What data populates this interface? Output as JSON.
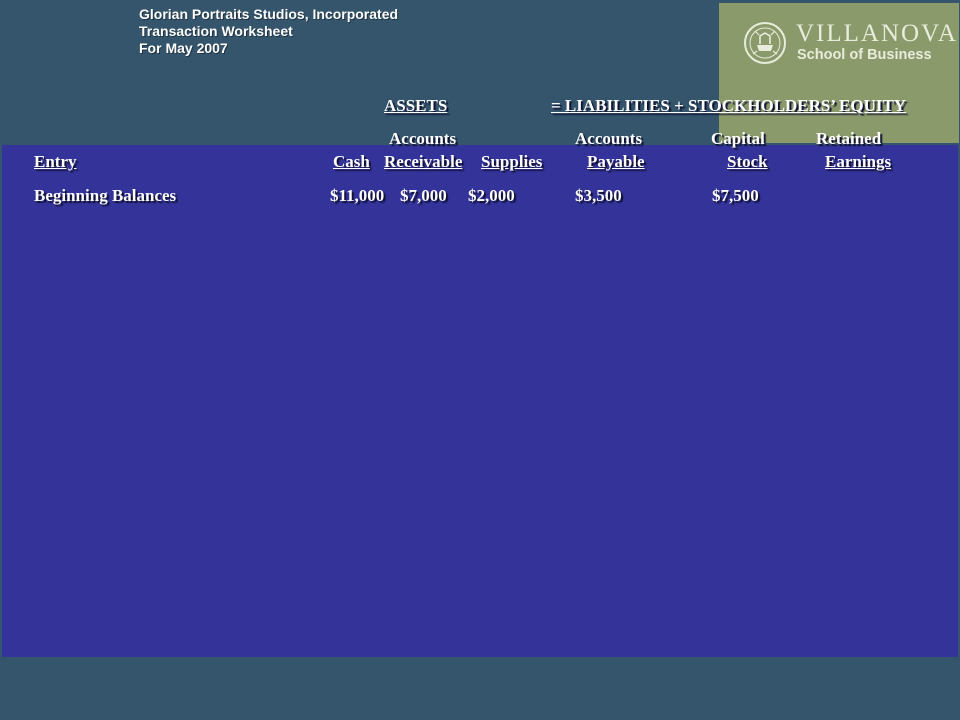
{
  "header": {
    "company": "Glorian Portraits Studios, Incorporated",
    "subtitle": "Transaction Worksheet",
    "period": "For May 2007"
  },
  "logo": {
    "title": "VILLANOVA",
    "subtitle": "School of Business"
  },
  "equation": {
    "assets": "ASSETS",
    "equals_rhs": "= LIABILITIES + STOCKHOLDERS’ EQUITY"
  },
  "columns": {
    "entry": "Entry",
    "cash": "Cash",
    "ar_top": "Accounts",
    "ar_bottom": "Receivable",
    "supplies": "Supplies",
    "ap_top": "Accounts",
    "ap_bottom": "Payable",
    "cs_top": "Capital",
    "cs_bottom": "Stock",
    "re_top": "Retained",
    "re_bottom": "Earnings"
  },
  "rows": [
    {
      "entry": "Beginning Balances",
      "cash": "$11,000",
      "ar": "$7,000",
      "supplies": "$2,000",
      "ap": "$3,500",
      "cs": "$7,500",
      "re": ""
    }
  ],
  "colors": {
    "background": "#34556b",
    "panel": "#333399",
    "logo_bg": "#8a9a6b"
  }
}
